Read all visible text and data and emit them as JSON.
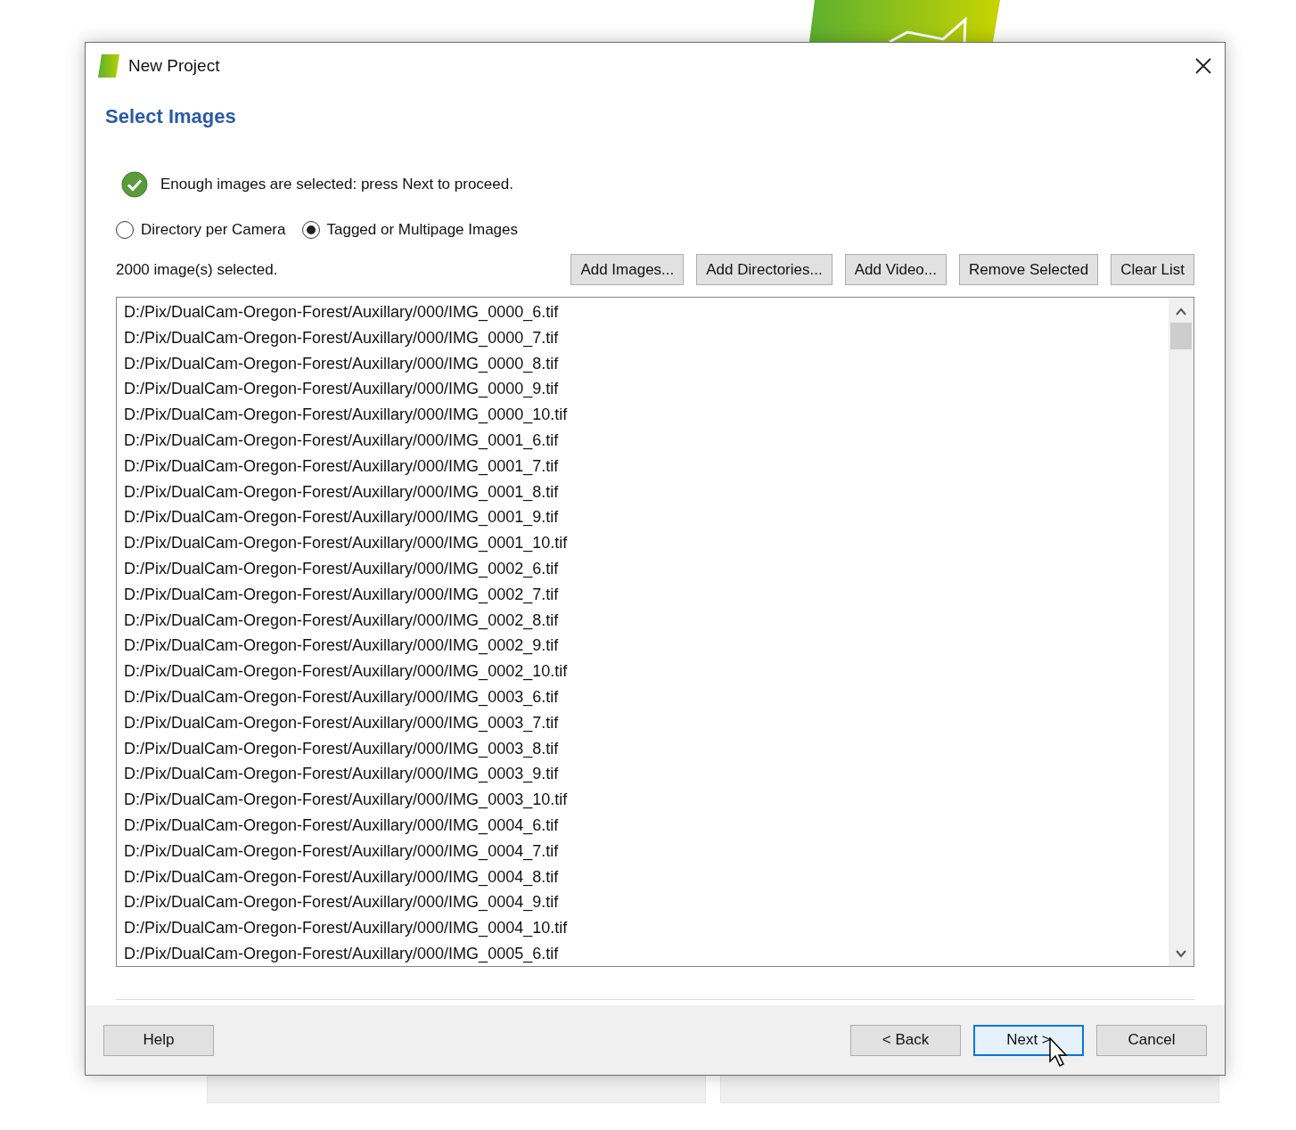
{
  "window": {
    "title": "New Project"
  },
  "heading": "Select Images",
  "status": {
    "ok": true,
    "message": "Enough images are selected: press Next to proceed."
  },
  "modes": [
    {
      "label": "Directory per Camera",
      "selected": false
    },
    {
      "label": "Tagged or Multipage Images",
      "selected": true
    }
  ],
  "count": "2000 image(s) selected.",
  "list_buttons": [
    "Add Images...",
    "Add Directories...",
    "Add Video...",
    "Remove Selected",
    "Clear List"
  ],
  "files": [
    "D:/Pix/DualCam-Oregon-Forest/Auxillary/000/IMG_0000_6.tif",
    "D:/Pix/DualCam-Oregon-Forest/Auxillary/000/IMG_0000_7.tif",
    "D:/Pix/DualCam-Oregon-Forest/Auxillary/000/IMG_0000_8.tif",
    "D:/Pix/DualCam-Oregon-Forest/Auxillary/000/IMG_0000_9.tif",
    "D:/Pix/DualCam-Oregon-Forest/Auxillary/000/IMG_0000_10.tif",
    "D:/Pix/DualCam-Oregon-Forest/Auxillary/000/IMG_0001_6.tif",
    "D:/Pix/DualCam-Oregon-Forest/Auxillary/000/IMG_0001_7.tif",
    "D:/Pix/DualCam-Oregon-Forest/Auxillary/000/IMG_0001_8.tif",
    "D:/Pix/DualCam-Oregon-Forest/Auxillary/000/IMG_0001_9.tif",
    "D:/Pix/DualCam-Oregon-Forest/Auxillary/000/IMG_0001_10.tif",
    "D:/Pix/DualCam-Oregon-Forest/Auxillary/000/IMG_0002_6.tif",
    "D:/Pix/DualCam-Oregon-Forest/Auxillary/000/IMG_0002_7.tif",
    "D:/Pix/DualCam-Oregon-Forest/Auxillary/000/IMG_0002_8.tif",
    "D:/Pix/DualCam-Oregon-Forest/Auxillary/000/IMG_0002_9.tif",
    "D:/Pix/DualCam-Oregon-Forest/Auxillary/000/IMG_0002_10.tif",
    "D:/Pix/DualCam-Oregon-Forest/Auxillary/000/IMG_0003_6.tif",
    "D:/Pix/DualCam-Oregon-Forest/Auxillary/000/IMG_0003_7.tif",
    "D:/Pix/DualCam-Oregon-Forest/Auxillary/000/IMG_0003_8.tif",
    "D:/Pix/DualCam-Oregon-Forest/Auxillary/000/IMG_0003_9.tif",
    "D:/Pix/DualCam-Oregon-Forest/Auxillary/000/IMG_0003_10.tif",
    "D:/Pix/DualCam-Oregon-Forest/Auxillary/000/IMG_0004_6.tif",
    "D:/Pix/DualCam-Oregon-Forest/Auxillary/000/IMG_0004_7.tif",
    "D:/Pix/DualCam-Oregon-Forest/Auxillary/000/IMG_0004_8.tif",
    "D:/Pix/DualCam-Oregon-Forest/Auxillary/000/IMG_0004_9.tif",
    "D:/Pix/DualCam-Oregon-Forest/Auxillary/000/IMG_0004_10.tif",
    "D:/Pix/DualCam-Oregon-Forest/Auxillary/000/IMG_0005_6.tif"
  ],
  "footer_buttons": [
    {
      "label": "Help",
      "focused": false
    },
    {
      "label": "< Back",
      "focused": false
    },
    {
      "label": "Next >",
      "focused": true
    },
    {
      "label": "Cancel",
      "focused": false
    }
  ]
}
